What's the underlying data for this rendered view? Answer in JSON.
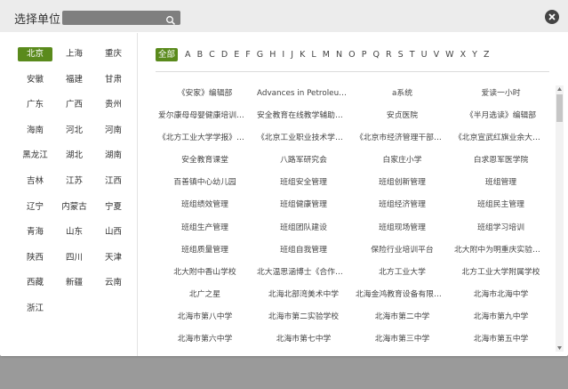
{
  "dialog": {
    "title": "选择单位",
    "search_placeholder": ""
  },
  "provinces": [
    "北京",
    "上海",
    "重庆",
    "安徽",
    "福建",
    "甘肃",
    "广东",
    "广西",
    "贵州",
    "海南",
    "河北",
    "河南",
    "黑龙江",
    "湖北",
    "湖南",
    "吉林",
    "江苏",
    "江西",
    "辽宁",
    "内蒙古",
    "宁夏",
    "青海",
    "山东",
    "山西",
    "陕西",
    "四川",
    "天津",
    "西藏",
    "新疆",
    "云南",
    "浙江"
  ],
  "provinces_active_index": 0,
  "letters": [
    "全部",
    "A",
    "B",
    "C",
    "D",
    "E",
    "F",
    "G",
    "H",
    "I",
    "J",
    "K",
    "L",
    "M",
    "N",
    "O",
    "P",
    "Q",
    "R",
    "S",
    "T",
    "U",
    "V",
    "W",
    "X",
    "Y",
    "Z"
  ],
  "letters_active_index": 0,
  "units": [
    "《安家》编辑部",
    "Advances in Petroleum ...",
    "a系统",
    "爱读一小时",
    "爱尔康母母婴健康培训中心",
    "安全教育在线教学辅助系统",
    "安贞医院",
    "《半月选读》编辑部",
    "《北方工业大学学报》编...",
    "《北京工业职业技术学院...",
    "《北京市经济管理干部学...",
    "《北京宣武红旗业余大学...",
    "安全教育课堂",
    "八路军研究会",
    "白家庄小学",
    "白求恩军医学院",
    "百善镇中心幼儿园",
    "班组安全管理",
    "班组创新管理",
    "班组管理",
    "班组绩效管理",
    "班组健康管理",
    "班组经济管理",
    "班组民主管理",
    "班组生产管理",
    "班组团队建设",
    "班组现场管理",
    "班组学习培训",
    "班组质量管理",
    "班组自我管理",
    "保险行业培训平台",
    "北大附中为明重庆实验学校",
    "北大附中香山学校",
    "北大温思涵博士《合作学...",
    "北方工业大学",
    "北方工业大学附属学校",
    "北广之星",
    "北海北部湾美术中学",
    "北海金鸿教育设备有限公司",
    "北海市北海中学",
    "北海市第八中学",
    "北海市第二实验学校",
    "北海市第二中学",
    "北海市第九中学",
    "北海市第六中学",
    "北海市第七中学",
    "北海市第三中学",
    "北海市第五中学"
  ],
  "colors": {
    "accent": "#5a8a1c",
    "header_bg": "#ececec",
    "backdrop": "#9a9a9a"
  },
  "icons": {
    "search": "search-icon",
    "close": "close-icon"
  }
}
